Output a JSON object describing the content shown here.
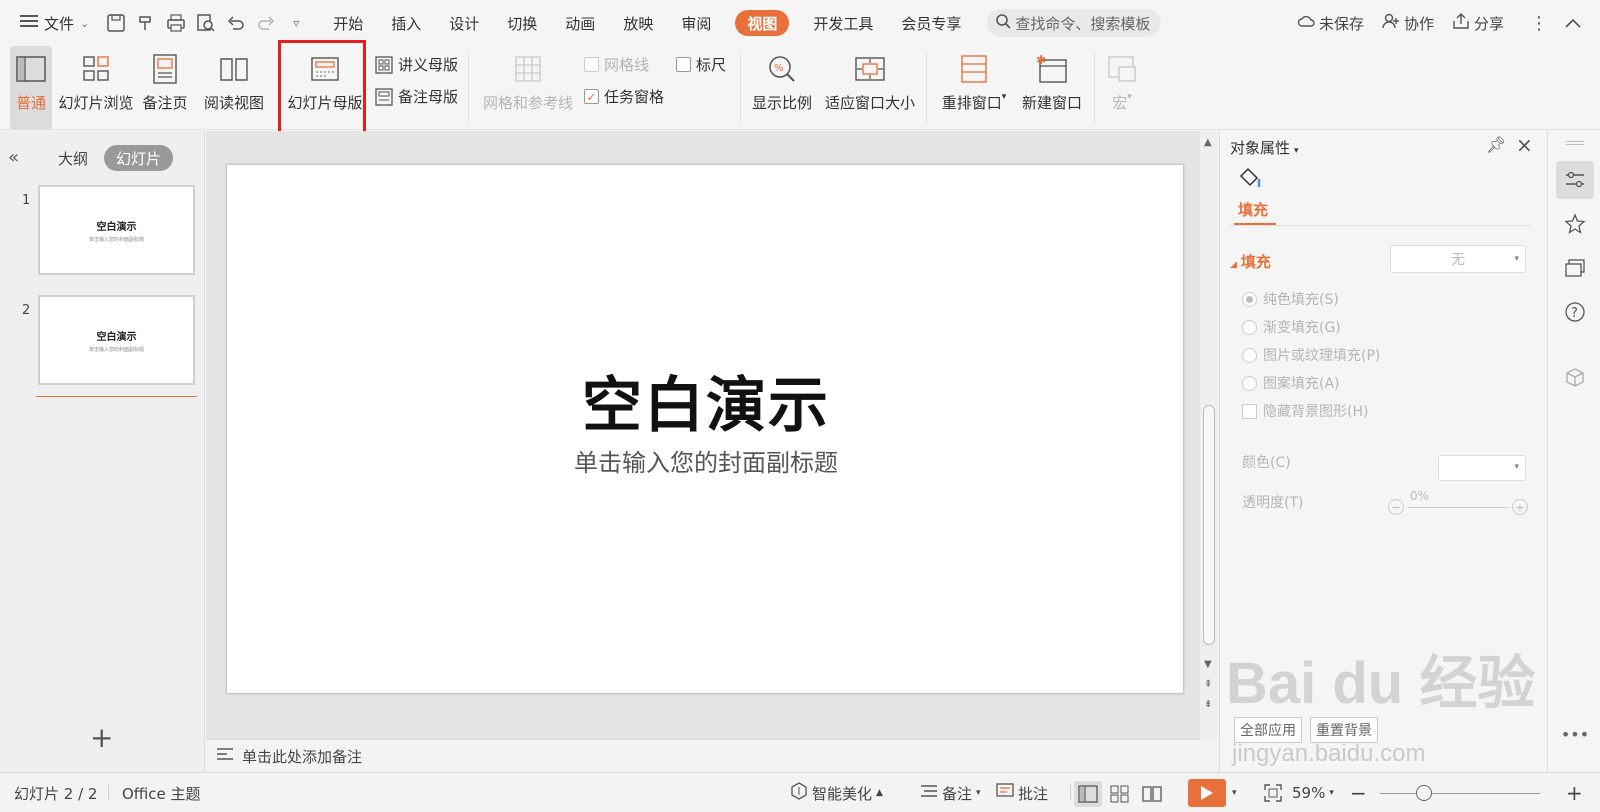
{
  "menubar": {
    "file_label": "文件",
    "tabs": [
      {
        "label": "开始"
      },
      {
        "label": "插入"
      },
      {
        "label": "设计"
      },
      {
        "label": "切换"
      },
      {
        "label": "动画"
      },
      {
        "label": "放映"
      },
      {
        "label": "审阅"
      },
      {
        "label": "视图"
      },
      {
        "label": "开发工具"
      },
      {
        "label": "会员专享"
      }
    ],
    "active_tab": "视图",
    "search_placeholder": "查找命令、搜索模板",
    "unsaved_label": "未保存",
    "collab_label": "协作",
    "share_label": "分享"
  },
  "ribbon": {
    "normal": "普通",
    "slide_sorter": "幻灯片浏览",
    "notes_page": "备注页",
    "reading_view": "阅读视图",
    "slide_master": "幻灯片母版",
    "handout_master": "讲义母版",
    "notes_master": "备注母版",
    "grid_guides": "网格和参考线",
    "gridlines": "网格线",
    "ruler": "标尺",
    "task_pane": "任务窗格",
    "zoom": "显示比例",
    "fit_window": "适应窗口大小",
    "arrange": "重排窗口",
    "new_window": "新建窗口",
    "macro": "宏"
  },
  "leftpanel": {
    "outline_tab": "大纲",
    "slides_tab": "幻灯片",
    "slides": [
      {
        "num": "1",
        "title": "空白演示",
        "subtitle": "单击输入您的封面副标题"
      },
      {
        "num": "2",
        "title": "空白演示",
        "subtitle": "单击输入您的封面副标题"
      }
    ],
    "add_symbol": "+"
  },
  "slide": {
    "title": "空白演示",
    "subtitle": "单击输入您的封面副标题"
  },
  "notes": {
    "placeholder": "单击此处添加备注"
  },
  "properties": {
    "title": "对象属性",
    "tab_fill": "填充",
    "section_fill": "填充",
    "fill_select": "无",
    "options": [
      {
        "label": "纯色填充(S)",
        "checked": true
      },
      {
        "label": "渐变填充(G)",
        "checked": false
      },
      {
        "label": "图片或纹理填充(P)",
        "checked": false
      },
      {
        "label": "图案填充(A)",
        "checked": false
      }
    ],
    "hide_bg_label": "隐藏背景图形(H)",
    "color_label": "颜色(C)",
    "transparency_label": "透明度(T)",
    "transparency_value": "0%",
    "apply_all": "全部应用",
    "reset_bg": "重置背景"
  },
  "statusbar": {
    "slide_info": "幻灯片 2 / 2",
    "theme": "Office 主题",
    "smart_beautify": "智能美化",
    "notes": "备注",
    "comments": "批注",
    "zoom_value": "59%"
  },
  "watermark": {
    "text": "Bai du 经验",
    "url": "jingyan.baidu.com"
  },
  "colors": {
    "accent": "#e8703a",
    "highlight": "#e02020"
  }
}
